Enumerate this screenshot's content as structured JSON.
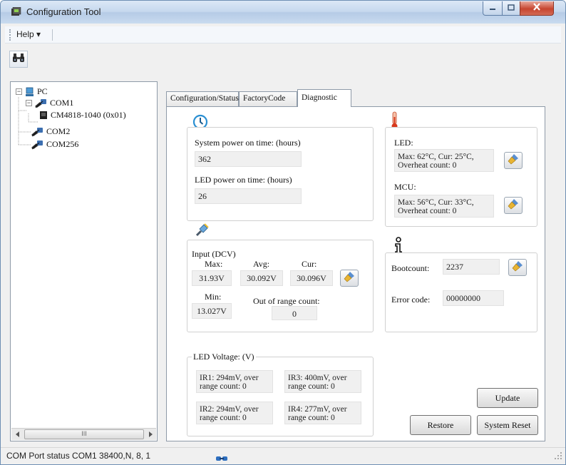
{
  "window": {
    "title": "Configuration Tool",
    "app_icon": "app-icon",
    "controls": [
      "minimize-icon",
      "maximize-icon",
      "close-icon"
    ]
  },
  "menu": {
    "help_label": "Help",
    "help_arrow": "▾"
  },
  "toolbar": {
    "search_icon": "binoculars-icon"
  },
  "tree": {
    "root": {
      "label": "PC",
      "expander": "−",
      "icon": "computer-icon"
    },
    "ports": [
      {
        "label": "COM1",
        "expander": "−",
        "icon": "port-icon",
        "children": [
          {
            "label": "CM4818-1040 (0x01)",
            "icon": "device-icon"
          }
        ]
      },
      {
        "label": "COM2",
        "icon": "port-icon"
      },
      {
        "label": "COM256",
        "icon": "port-icon"
      }
    ],
    "scroll_thumb_label": "III"
  },
  "tabs": [
    {
      "label": "Configuration/Status",
      "selected": false
    },
    {
      "label": "FactoryCode",
      "selected": false
    },
    {
      "label": "Diagnostic",
      "selected": true
    }
  ],
  "power": {
    "icon": "clock-icon",
    "system_label": "System power on time: (hours)",
    "system_value": "362",
    "led_label": "LED power on time: (hours)",
    "led_value": "26"
  },
  "temperature": {
    "icon": "thermometer-icon",
    "led_label": "LED:",
    "led_line1": "Max: 62°C, Cur: 25°C,",
    "led_line2": "Overheat count: 0",
    "mcu_label": "MCU:",
    "mcu_line1": "Max: 56°C, Cur: 33°C,",
    "mcu_line2": "Overheat count: 0"
  },
  "input": {
    "icon": "plug-icon",
    "title": "Input (DCV)",
    "max_label": "Max:",
    "avg_label": "Avg:",
    "cur_label": "Cur:",
    "max_value": "31.93V",
    "avg_value": "30.092V",
    "cur_value": "30.096V",
    "min_label": "Min:",
    "min_value": "13.027V",
    "out_of_range_label": "Out of range count:",
    "out_of_range_value": "0"
  },
  "info": {
    "icon": "info-icon",
    "bootcount_label": "Bootcount:",
    "bootcount_value": "2237",
    "error_label": "Error code:",
    "error_value": "00000000"
  },
  "led_voltage": {
    "title": "LED Voltage: (V)",
    "ir": [
      {
        "line1": "IR1: 294mV, over",
        "line2": "range count: 0"
      },
      {
        "line1": "IR3: 400mV, over",
        "line2": "range count: 0"
      },
      {
        "line1": "IR2: 294mV, over",
        "line2": "range count: 0"
      },
      {
        "line1": "IR4: 277mV, over",
        "line2": "range count: 0"
      }
    ]
  },
  "buttons": {
    "update": "Update",
    "restore": "Restore",
    "system_reset": "System Reset",
    "reset_icon": "brush-icon"
  },
  "status": {
    "text": "COM Port status  COM1 38400,N, 8, 1",
    "icon": "connection-icon"
  }
}
